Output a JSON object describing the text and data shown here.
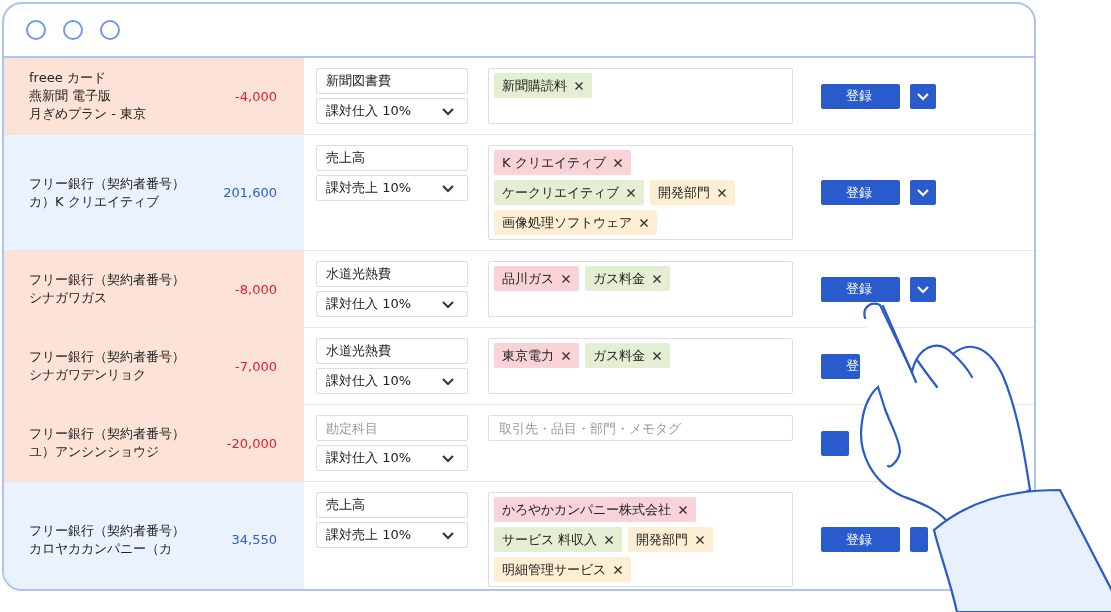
{
  "rows": [
    {
      "kind": "expense",
      "description_lines": [
        "freee カード",
        "燕新聞 電子版",
        "月ぎめプラン - 東京"
      ],
      "amount": "-4,000",
      "account": {
        "value": "新聞図書費"
      },
      "tax": "課対仕入 10%",
      "tag_lines": [
        [
          {
            "label": "新聞購読料",
            "color": "#e3eed3"
          }
        ]
      ],
      "register_label": "登録",
      "menu_button": true
    },
    {
      "kind": "income",
      "description_lines": [
        "フリー銀行（契約者番号）",
        "カ）K クリエイティブ"
      ],
      "amount": "201,600",
      "account": {
        "value": "売上高"
      },
      "tax": "課対売上 10%",
      "tag_lines": [
        [
          {
            "label": "K クリエイティブ",
            "color": "#fad3d9"
          }
        ],
        [
          {
            "label": "ケークリエイティブ",
            "color": "#e3eed3"
          },
          {
            "label": "開発部門",
            "color": "#fdefd3"
          }
        ],
        [
          {
            "label": "画像処理ソフトウェア",
            "color": "#fdefd3"
          }
        ]
      ],
      "register_label": "登録",
      "menu_button": true
    },
    {
      "kind": "expense",
      "description_lines": [
        "フリー銀行（契約者番号）",
        "シナガワガス"
      ],
      "amount": "-8,000",
      "account": {
        "value": "水道光熱費"
      },
      "tax": "課対仕入 10%",
      "tag_lines": [
        [
          {
            "label": "品川ガス",
            "color": "#fad3d9"
          },
          {
            "label": "ガス料金",
            "color": "#e3eed3"
          }
        ]
      ],
      "register_label": "登録",
      "menu_button": true
    },
    {
      "kind": "expense",
      "description_lines": [
        "フリー銀行（契約者番号）",
        "シナガワデンリョク"
      ],
      "amount": "-7,000",
      "account": {
        "value": "水道光熱費"
      },
      "tax": "課対仕入 10%",
      "tag_lines": [
        [
          {
            "label": "東京電力",
            "color": "#fad3d9"
          },
          {
            "label": "ガス料金",
            "color": "#e3eed3"
          }
        ]
      ],
      "register_label": "登",
      "menu_button": false
    },
    {
      "kind": "expense",
      "description_lines": [
        "フリー銀行（契約者番号）",
        "ユ）アンシンショウジ"
      ],
      "amount": "-20,000",
      "account": {
        "placeholder": "勘定科目"
      },
      "tax": "課対仕入 10%",
      "tags_placeholder": "取引先・品目・部門・メモタグ",
      "menu_button": false
    },
    {
      "kind": "income",
      "description_lines": [
        "フリー銀行（契約者番号）",
        "カロヤカカンパニー（カ"
      ],
      "amount": "34,550",
      "account": {
        "value": "売上高"
      },
      "tax": "課対売上 10%",
      "tag_lines": [
        [
          {
            "label": "かろやかカンパニー株式会社",
            "color": "#fad3d9"
          }
        ],
        [
          {
            "label": "サービス 料収入",
            "color": "#e3eed3"
          },
          {
            "label": "開発部門",
            "color": "#fdefd3"
          }
        ],
        [
          {
            "label": "明細管理サービス",
            "color": "#fdefd3"
          }
        ]
      ],
      "register_label": "登録",
      "menu_button": true
    }
  ]
}
